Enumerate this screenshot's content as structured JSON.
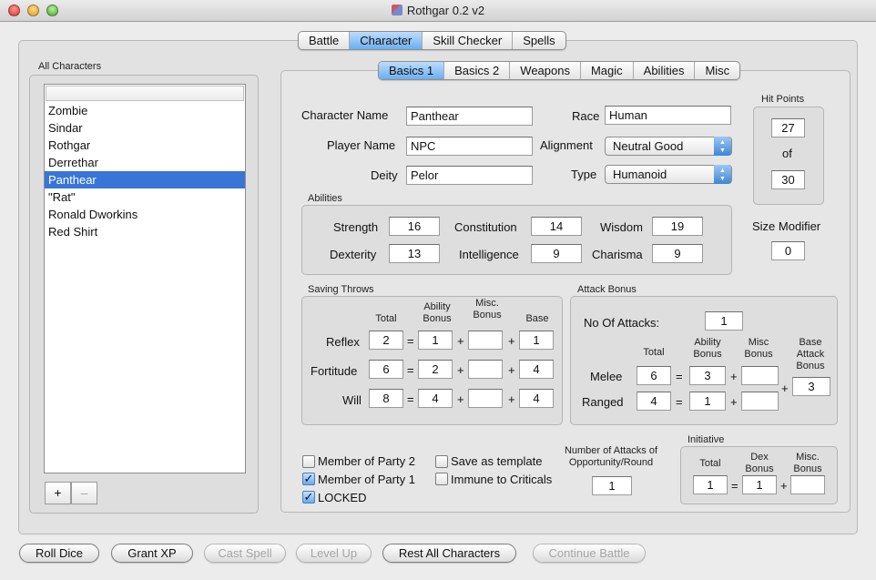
{
  "window": {
    "title": "Rothgar 0.2 v2"
  },
  "top_tabs": [
    {
      "label": "Battle"
    },
    {
      "label": "Character"
    },
    {
      "label": "Skill Checker"
    },
    {
      "label": "Spells"
    }
  ],
  "all_characters": {
    "heading": "All Characters",
    "search": "",
    "items": [
      {
        "label": "Zombie"
      },
      {
        "label": "Sindar"
      },
      {
        "label": "Rothgar"
      },
      {
        "label": "Derrethar"
      },
      {
        "label": "Panthear"
      },
      {
        "label": "\"Rat\""
      },
      {
        "label": "Ronald Dworkins"
      },
      {
        "label": "Red Shirt"
      }
    ],
    "add_label": "+",
    "remove_label": "–"
  },
  "sub_tabs": [
    {
      "label": "Basics 1"
    },
    {
      "label": "Basics 2"
    },
    {
      "label": "Weapons"
    },
    {
      "label": "Magic"
    },
    {
      "label": "Abilities"
    },
    {
      "label": "Misc"
    }
  ],
  "basics": {
    "character_name_label": "Character Name",
    "character_name": "Panthear",
    "player_name_label": "Player Name",
    "player_name": "NPC",
    "deity_label": "Deity",
    "deity": "Pelor",
    "race_label": "Race",
    "race": "Human",
    "alignment_label": "Alignment",
    "alignment": "Neutral Good",
    "type_label": "Type",
    "type": "Humanoid"
  },
  "hit_points": {
    "heading": "Hit Points",
    "current": "27",
    "of_label": "of",
    "max": "30"
  },
  "size_modifier": {
    "label": "Size Modifier",
    "value": "0"
  },
  "abilities": {
    "heading": "Abilities",
    "strength_label": "Strength",
    "strength": "16",
    "constitution_label": "Constitution",
    "constitution": "14",
    "wisdom_label": "Wisdom",
    "wisdom": "19",
    "dexterity_label": "Dexterity",
    "dexterity": "13",
    "intelligence_label": "Intelligence",
    "intelligence": "9",
    "charisma_label": "Charisma",
    "charisma": "9"
  },
  "saving_throws": {
    "heading": "Saving Throws",
    "total_header": "Total",
    "ability_bonus_header_1": "Ability",
    "ability_bonus_header_2": "Bonus",
    "misc_bonus_header_1": "Misc.",
    "misc_bonus_header_2": "Bonus",
    "base_header": "Base",
    "eq": "=",
    "plus": "+",
    "rows": [
      {
        "label": "Reflex",
        "total": "2",
        "ability": "1",
        "misc": "",
        "base": "1"
      },
      {
        "label": "Fortitude",
        "total": "6",
        "ability": "2",
        "misc": "",
        "base": "4"
      },
      {
        "label": "Will",
        "total": "8",
        "ability": "4",
        "misc": "",
        "base": "4"
      }
    ]
  },
  "attack_bonus": {
    "heading": "Attack Bonus",
    "no_attacks_label": "No Of Attacks:",
    "no_attacks": "1",
    "total_header": "Total",
    "ability_bonus_header_1": "Ability",
    "ability_bonus_header_2": "Bonus",
    "misc_bonus_header_1": "Misc",
    "misc_bonus_header_2": "Bonus",
    "base_header_1": "Base",
    "base_header_2": "Attack",
    "base_header_3": "Bonus",
    "base_value": "3",
    "eq": "=",
    "plus": "+",
    "melee_label": "Melee",
    "melee_total": "6",
    "melee_ability": "3",
    "melee_misc": "",
    "ranged_label": "Ranged",
    "ranged_total": "4",
    "ranged_ability": "1",
    "ranged_misc": ""
  },
  "options": {
    "member_party_2": "Member of Party 2",
    "member_party_1": "Member of Party 1",
    "locked": "LOCKED",
    "save_template": "Save as template",
    "immune_criticals": "Immune to Criticals",
    "check_mark": "✓"
  },
  "aoo": {
    "label_1": "Number of Attacks of",
    "label_2": "Opportunity/Round",
    "value": "1"
  },
  "initiative": {
    "heading": "Initiative",
    "total_header": "Total",
    "dex_header_1": "Dex",
    "dex_header_2": "Bonus",
    "misc_header_1": "Misc.",
    "misc_header_2": "Bonus",
    "total": "1",
    "dex": "1",
    "misc": "",
    "eq": "=",
    "plus": "+"
  },
  "bottom_buttons": {
    "roll_dice": "Roll Dice",
    "grant_xp": "Grant XP",
    "cast_spell": "Cast Spell",
    "level_up": "Level Up",
    "rest_all": "Rest All Characters",
    "continue_battle": "Continue Battle"
  },
  "colors": {
    "selection": "#3875d7",
    "tab_selected": "#6aaef2"
  }
}
